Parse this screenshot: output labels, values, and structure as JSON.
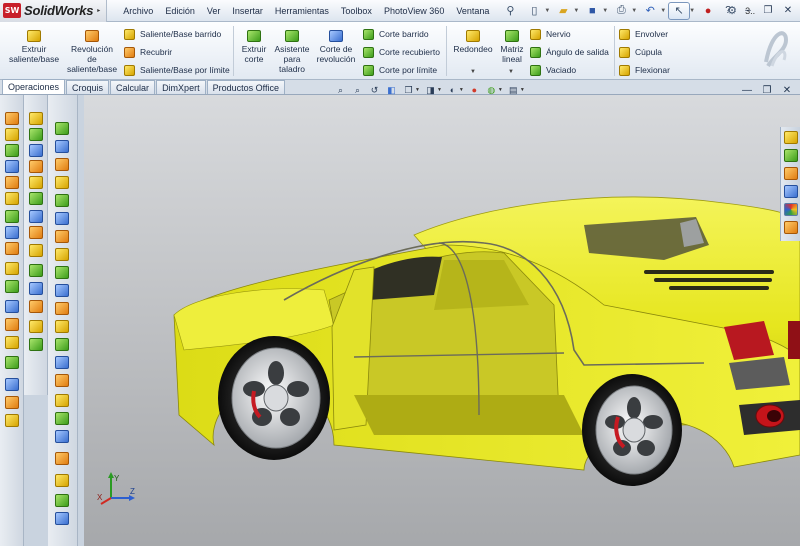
{
  "app": {
    "logo_mark": "SW",
    "name": "SolidWorks"
  },
  "menu": [
    "Archivo",
    "Edición",
    "Ver",
    "Insertar",
    "Herramientas",
    "Toolbox",
    "PhotoView 360",
    "Ventana"
  ],
  "quick_access": {
    "icons": [
      "pin-icon",
      "new-file-icon",
      "open-folder-icon",
      "save-icon",
      "print-icon",
      "undo-icon",
      "select-pointer-icon",
      "traffic-light-icon",
      "options-icon"
    ],
    "trailing_text": "3..",
    "help_mark": "?"
  },
  "command_manager": {
    "large_buttons": [
      {
        "id": "extruir",
        "label": "Extruir saliente/base",
        "icon": "extrude-boss-icon"
      },
      {
        "id": "revolucion",
        "label": "Revolución de saliente/base",
        "icon": "revolve-boss-icon"
      },
      {
        "id": "extruir-corte",
        "label": "Extruir corte",
        "icon": "extrude-cut-icon"
      },
      {
        "id": "asistente",
        "label": "Asistente para taladro",
        "icon": "hole-wizard-icon"
      },
      {
        "id": "corte-revolucion",
        "label": "Corte de revolución",
        "icon": "revolve-cut-icon"
      },
      {
        "id": "redondeo",
        "label": "Redondeo",
        "icon": "fillet-icon"
      },
      {
        "id": "matriz",
        "label": "Matriz lineal",
        "icon": "linear-pattern-icon"
      }
    ],
    "small_buttons": [
      [
        "Saliente/Base barrido",
        "Recubrir",
        "Saliente/Base por límite"
      ],
      [
        "Corte barrido",
        "Corte recubierto",
        "Corte por límite"
      ],
      [
        "Nervio",
        "Ángulo de salida",
        "Vaciado"
      ],
      [
        "Envolver",
        "Cúpula",
        "Flexionar"
      ]
    ]
  },
  "tabs": [
    {
      "label": "Operaciones",
      "active": true
    },
    {
      "label": "Croquis",
      "active": false
    },
    {
      "label": "Calcular",
      "active": false
    },
    {
      "label": "DimXpert",
      "active": false
    },
    {
      "label": "Productos Office",
      "active": false
    }
  ],
  "heads_up_toolbar": [
    "zoom-to-fit-icon",
    "zoom-to-area-icon",
    "previous-view-icon",
    "section-view-icon",
    "view-orientation-icon",
    "display-style-icon",
    "hide-show-icon",
    "edit-appearance-icon",
    "apply-scene-icon",
    "view-settings-icon"
  ],
  "window_controls": [
    "minimize-icon",
    "restore-icon",
    "close-icon"
  ],
  "task_pane": [
    "resources-icon",
    "design-library-icon",
    "file-explorer-icon",
    "view-palette-icon",
    "appearances-icon",
    "custom-properties-icon"
  ],
  "triad": {
    "x": "X",
    "y": "Y",
    "z": "Z"
  },
  "colors": {
    "car_body": "#e6e61e",
    "viewport_top": "#d8dadd",
    "viewport_bottom": "#a6a8ab",
    "accent": "#c8202a"
  }
}
